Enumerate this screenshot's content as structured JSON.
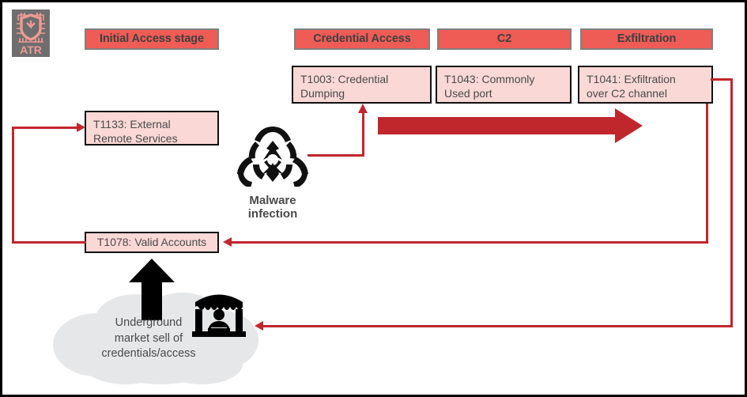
{
  "logo": {
    "name": "atr-logo",
    "text": "ATR",
    "background": "#6e6e6e",
    "accent": "#f09a93"
  },
  "stages": [
    {
      "id": "initial-access",
      "label": "Initial Access stage"
    },
    {
      "id": "credential-access",
      "label": "Credential Access"
    },
    {
      "id": "c2",
      "label": "C2"
    },
    {
      "id": "exfiltration",
      "label": "Exfiltration"
    }
  ],
  "techniques": [
    {
      "id": "t1003",
      "label": "T1003: Credential\nDumping"
    },
    {
      "id": "t1043",
      "label": "T1043: Commonly\nUsed port"
    },
    {
      "id": "t1041",
      "label": "T1041: Exfiltration\nover C2 channel"
    },
    {
      "id": "t1133",
      "label": "T1133: External\nRemote Services"
    },
    {
      "id": "t1078",
      "label": "T1078: Valid Accounts"
    }
  ],
  "icons": {
    "malware": {
      "name": "biohazard-icon",
      "label": "Malware\ninfection",
      "color": "#111111"
    },
    "market": {
      "name": "market-stall-icon",
      "color": "#000000"
    },
    "up_arrow": {
      "name": "black-up-arrow",
      "color": "#000000"
    }
  },
  "cloud": {
    "name": "underground-market-cloud",
    "label": "Underground\nmarket sell of\ncredentials/access",
    "fill": "#e6e7e8"
  },
  "flow_arrow": {
    "name": "progression-arrow",
    "color": "#c0272d"
  },
  "colors": {
    "stage_fill": "#ee5c55",
    "stage_border": "#7f7f7f",
    "technique_fill": "#f9d8d5",
    "technique_border": "#111111",
    "connector": "#c0272d",
    "text": "#4a4a4a",
    "page_border": "#000000"
  }
}
